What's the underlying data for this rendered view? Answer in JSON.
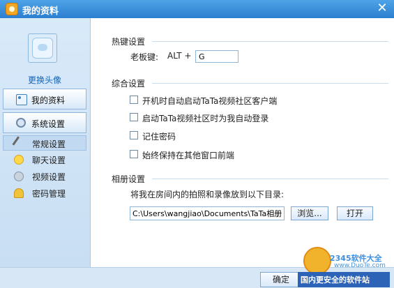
{
  "window": {
    "title": "我的资料"
  },
  "sidebar": {
    "change_avatar": "更换头像",
    "items": [
      {
        "label": "我的资料"
      },
      {
        "label": "系统设置"
      }
    ],
    "sub_items": [
      {
        "label": "常规设置",
        "selected": true
      },
      {
        "label": "聊天设置"
      },
      {
        "label": "视频设置"
      },
      {
        "label": "密码管理"
      }
    ]
  },
  "hotkeys": {
    "section_title": "热键设置",
    "boss_key_label": "老板键:",
    "modifier": "ALT +",
    "key_value": "G"
  },
  "general": {
    "section_title": "综合设置",
    "options": [
      {
        "label": "开机时自动启动TaTa视频社区客户端",
        "checked": false
      },
      {
        "label": "启动TaTa视频社区时为我自动登录",
        "checked": false
      },
      {
        "label": "记住密码",
        "checked": false
      },
      {
        "label": "始终保持在其他窗口前端",
        "checked": false
      }
    ]
  },
  "album": {
    "section_title": "相册设置",
    "description": "将我在房间内的拍照和录像放到以下目录:",
    "path": "C:\\Users\\wangjiao\\Documents\\TaTa相册",
    "browse_label": "浏览...",
    "open_label": "打开"
  },
  "footer": {
    "ok_label": "确定",
    "watermark": {
      "line1": "2345软件大全",
      "line2": "www.DuoTe.com",
      "line3": "国内更安全的软件站"
    }
  }
}
